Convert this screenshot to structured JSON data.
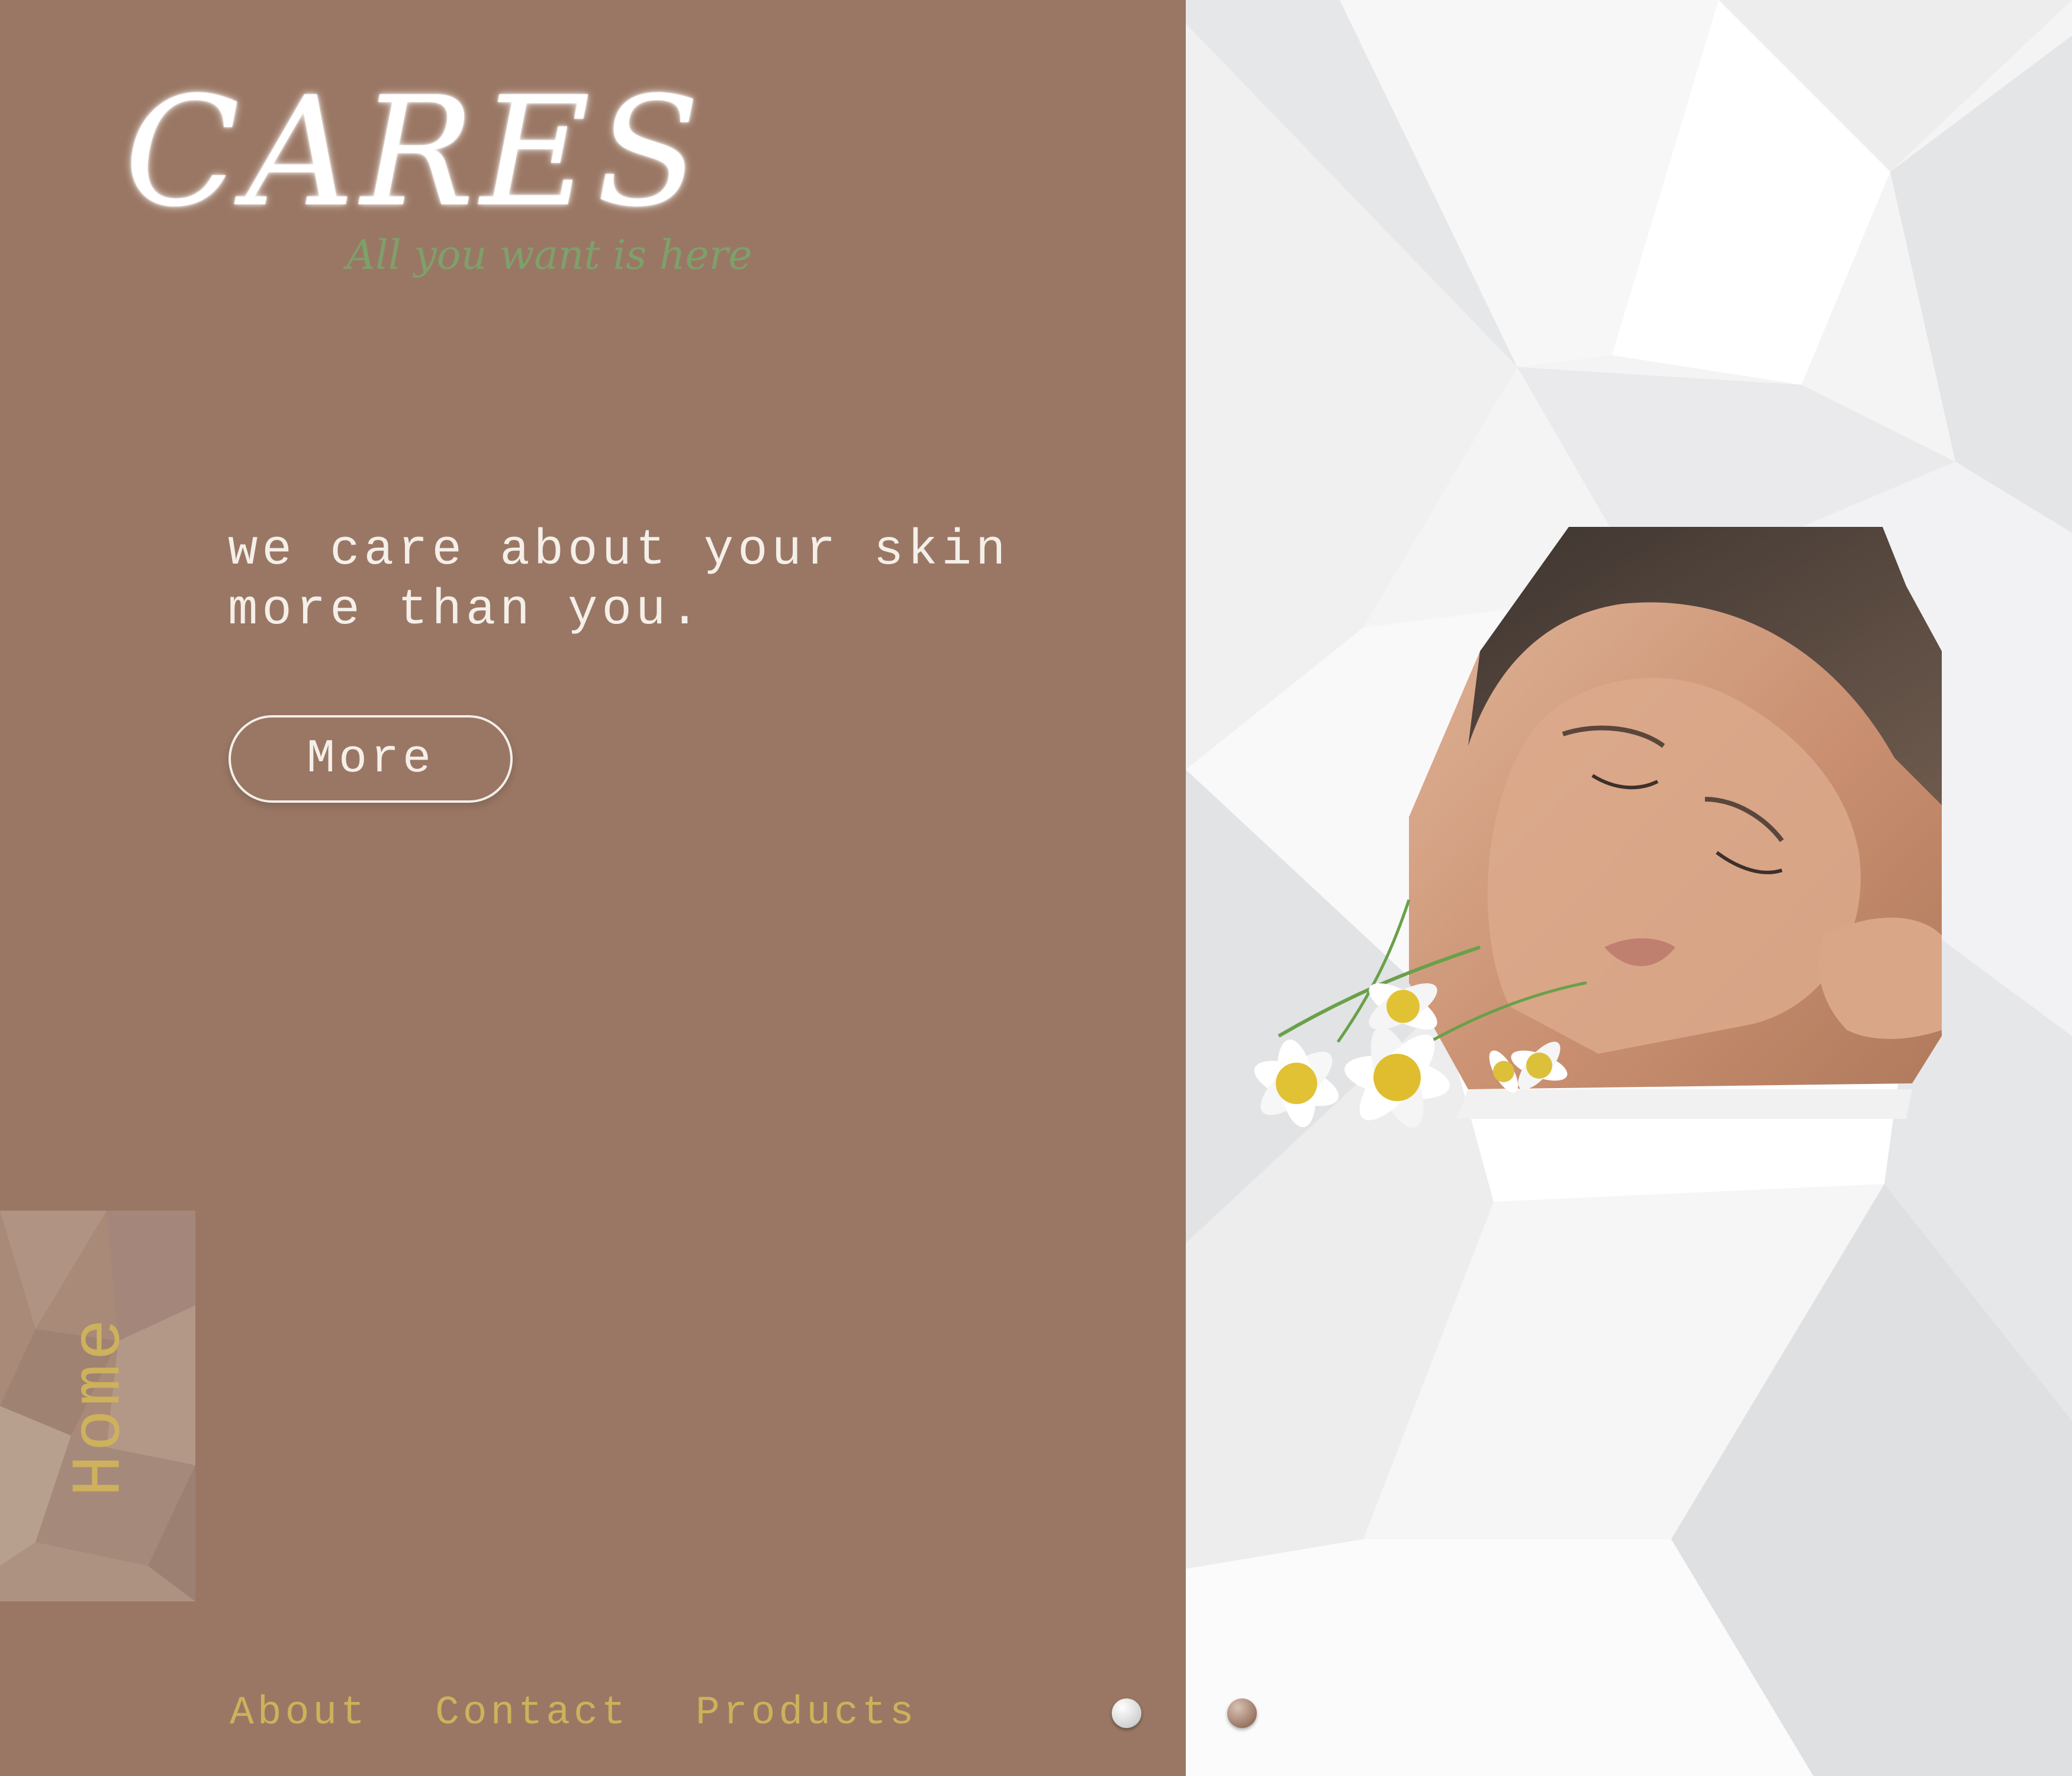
{
  "brand": {
    "logo_text": "CARES",
    "tagline": "All you want is here"
  },
  "hero": {
    "headline_line1": "we care about your skin",
    "headline_line2": "more than you.",
    "more_button_label": "More"
  },
  "side_tab": {
    "label": "Home"
  },
  "nav": {
    "items": [
      {
        "label": "About"
      },
      {
        "label": "Contact"
      },
      {
        "label": "Products"
      }
    ]
  },
  "slider": {
    "slide_count": 2,
    "active_index": 0
  },
  "colors": {
    "panel_brown": "#9a7764",
    "nav_gold": "#cdb15c",
    "tagline_green": "#7ea06a",
    "text_light": "#f4efe9"
  },
  "images": {
    "hero_image": "woman-face-with-chamomile-flowers"
  }
}
